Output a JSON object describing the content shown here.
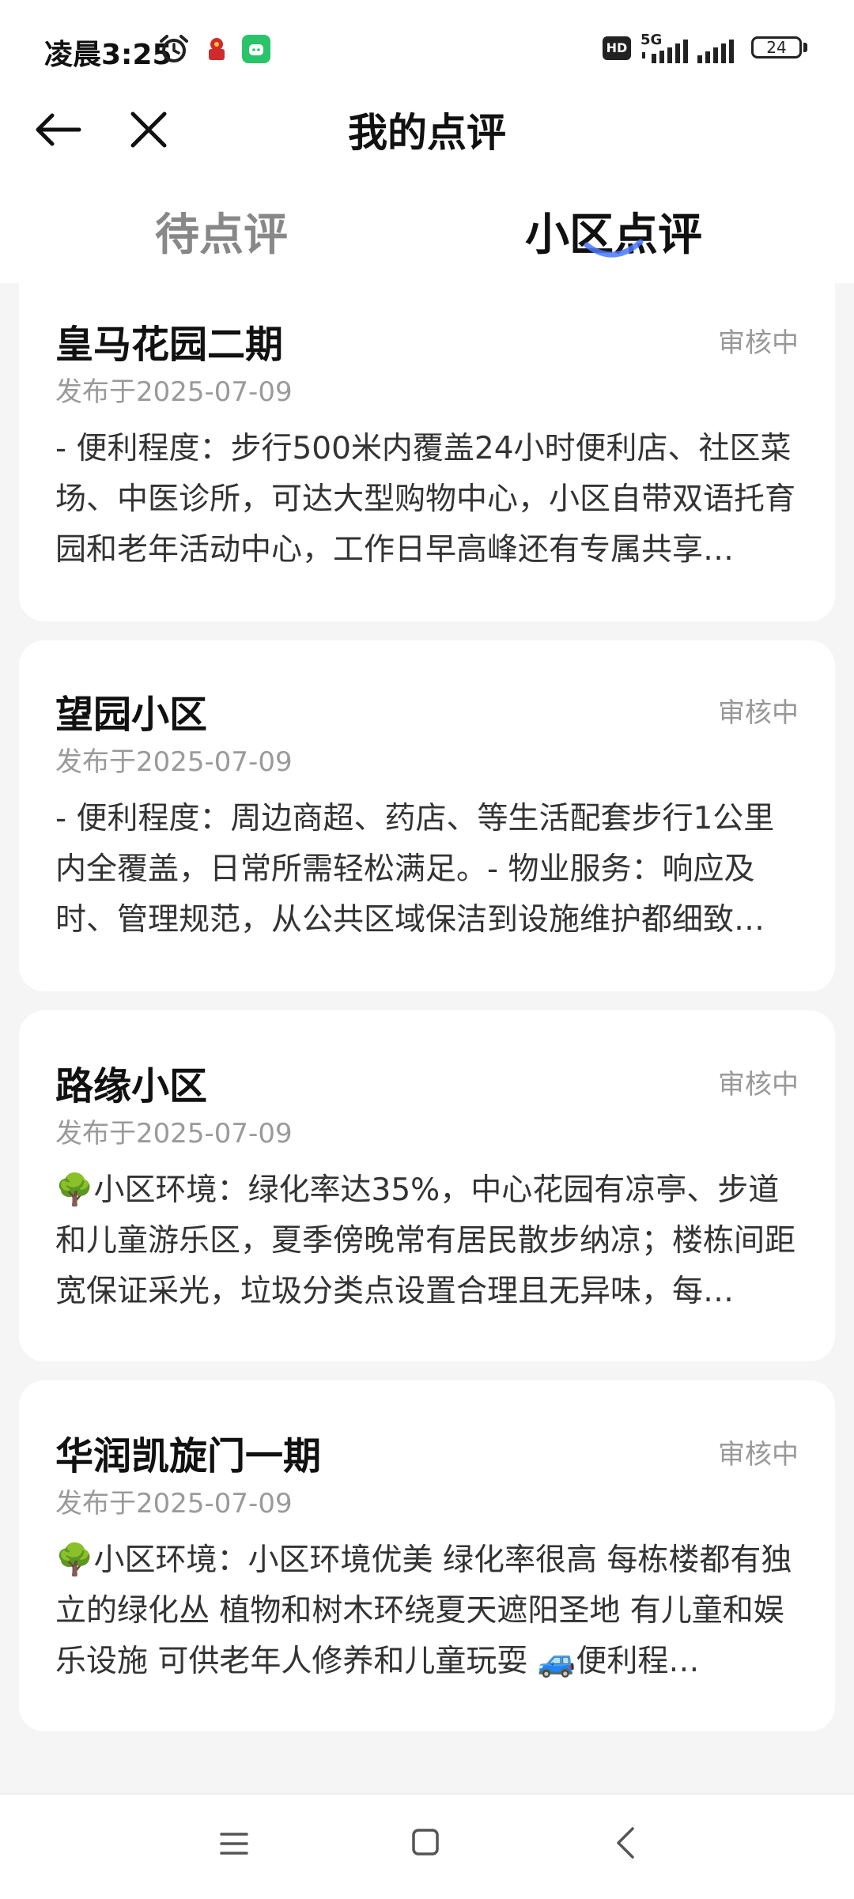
{
  "status_bar": {
    "time": "凌晨3:25",
    "hd_badge": "HD",
    "network": "5G",
    "battery": "24"
  },
  "header": {
    "title": "我的点评"
  },
  "tabs": [
    {
      "label": "待点评",
      "active": false
    },
    {
      "label": "小区点评",
      "active": true
    }
  ],
  "colors": {
    "accent": "#4a78ff",
    "background": "#f5f5f5",
    "card": "#ffffff",
    "muted_text": "#999999"
  },
  "reviews": [
    {
      "title": "皇马花园二期",
      "status": "审核中",
      "date": "发布于2025-07-09",
      "body": "- 便利程度：步行500米内覆盖24小时便利店、社区菜场、中医诊所，可达大型购物中心，小区自带双语托育园和老年活动中心，工作日早高峰还有专属共享…"
    },
    {
      "title": "望园小区",
      "status": "审核中",
      "date": "发布于2025-07-09",
      "body": "- 便利程度：周边商超、药店、等生活配套步行1公里内全覆盖，日常所需轻松满足。- 物业服务：响应及时、管理规范，从公共区域保洁到设施维护都细致…"
    },
    {
      "title": "路缘小区",
      "status": "审核中",
      "date": "发布于2025-07-09",
      "body": "🌳小区环境：绿化率达35%，中心花园有凉亭、步道和儿童游乐区，夏季傍晚常有居民散步纳凉；楼栋间距宽保证采光，垃圾分类点设置合理且无异味，每…"
    },
    {
      "title": "华润凯旋门一期",
      "status": "审核中",
      "date": "发布于2025-07-09",
      "body": "🌳小区环境：小区环境优美 绿化率很高 每栋楼都有独立的绿化丛 植物和树木环绕夏天遮阳圣地 有儿童和娱乐设施 可供老年人修养和儿童玩耍 🚙便利程…"
    }
  ]
}
